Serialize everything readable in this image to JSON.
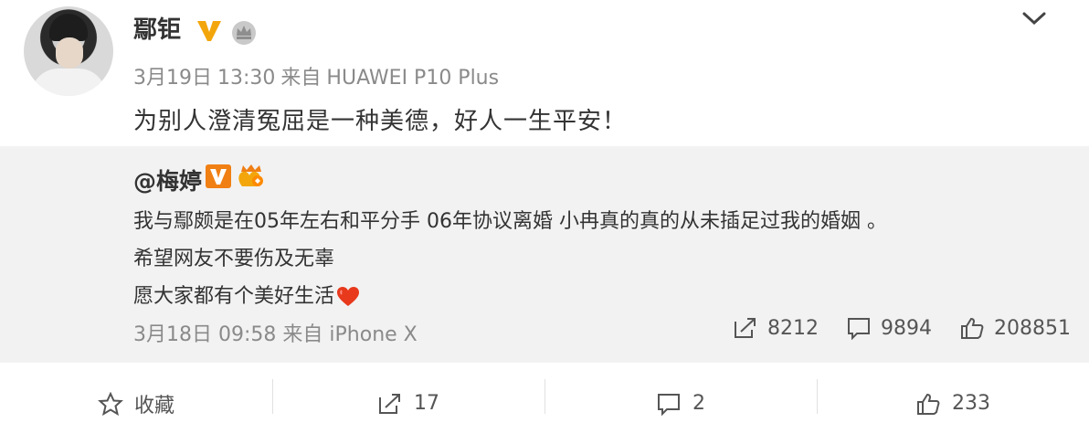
{
  "post": {
    "username": "鄢钜",
    "date": "3月19日",
    "time": "13:30",
    "via": "来自",
    "device": "HUAWEI P10 Plus",
    "content": "为别人澄清冤屈是一种美德，好人一生平安！"
  },
  "repost": {
    "username": "@梅婷",
    "lines": [
      "我与鄢颇是在05年左右和平分手  06年协议离婚 小冉真的真的从未插足过我的婚姻 。",
      "希望网友不要伤及无辜",
      "愿大家都有个美好生活"
    ],
    "date": "3月18日",
    "time": "09:58",
    "via": "来自",
    "device": "iPhone X",
    "stats": {
      "repost": "8212",
      "comment": "9894",
      "like": "208851"
    }
  },
  "actions": {
    "favorite_label": "收藏",
    "repost_count": "17",
    "comment_count": "2",
    "like_count": "233"
  },
  "icons": {
    "verified": "v-badge-icon",
    "crown": "crown-icon",
    "chevron": "chevron-down-icon",
    "heart": "heart-icon",
    "repost": "repost-icon",
    "comment": "comment-icon",
    "like": "thumbs-up-icon",
    "favorite": "star-icon"
  },
  "colors": {
    "verified_gold": "#f3a60b",
    "verified_orange": "#f07f14",
    "muted_text": "#8a8a8a",
    "repost_bg": "#f2f2f2",
    "heart_red": "#e8391d"
  }
}
